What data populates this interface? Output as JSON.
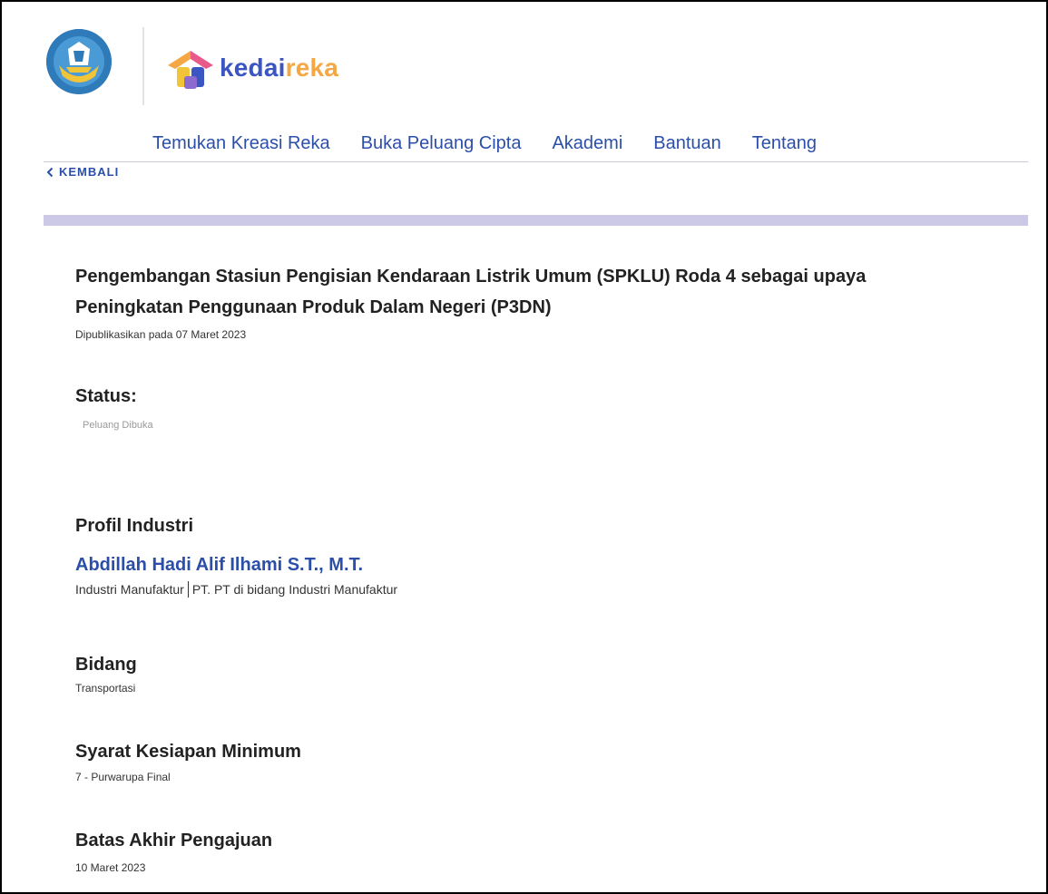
{
  "brand": {
    "name_part1": "kedai",
    "name_part2": "reka",
    "colors": {
      "blue": "#3b55c2",
      "orange": "#f4a742"
    }
  },
  "nav": {
    "items": [
      {
        "label": "Temukan Kreasi Reka"
      },
      {
        "label": "Buka Peluang Cipta"
      },
      {
        "label": "Akademi"
      },
      {
        "label": "Bantuan"
      },
      {
        "label": "Tentang"
      }
    ]
  },
  "back": {
    "label": "KEMBALI",
    "icon": "chevron-left-icon"
  },
  "page": {
    "title": "Pengembangan Stasiun Pengisian Kendaraan Listrik Umum (SPKLU) Roda 4 sebagai upaya Peningkatan Penggunaan Produk Dalam Negeri (P3DN)",
    "published": "Dipublikasikan pada 07 Maret 2023"
  },
  "status": {
    "heading": "Status:",
    "value": "Peluang Dibuka"
  },
  "profile": {
    "heading": "Profil Industri",
    "name": "Abdillah Hadi Alif Ilhami S.T., M.T.",
    "sector": "Industri Manufaktur",
    "company": "PT. PT di bidang Industri Manufaktur"
  },
  "field": {
    "heading": "Bidang",
    "value": "Transportasi"
  },
  "readiness": {
    "heading": "Syarat Kesiapan Minimum",
    "value": "7 - Purwarupa Final"
  },
  "deadline": {
    "heading": "Batas Akhir Pengajuan",
    "value": "10 Maret 2023"
  },
  "colors": {
    "accent": "#2b4fa8",
    "divider_bar": "#cbc9e6"
  }
}
